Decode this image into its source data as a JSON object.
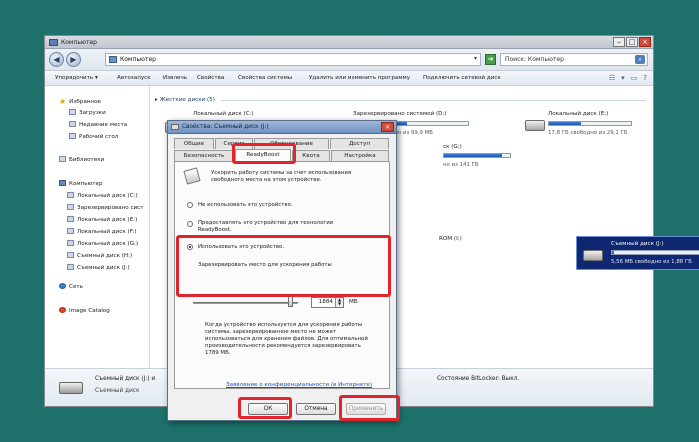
{
  "window": {
    "title": "Компьютер",
    "address": "Компьютер",
    "search_placeholder": "Поиск: Компьютер"
  },
  "commands": [
    "Упорядочить ▾",
    "Автозапуск",
    "Извлечь",
    "Свойства",
    "Свойства системы",
    "Удалить или изменить программу",
    "Подключить сетевой диск"
  ],
  "sidebar": {
    "favorites": "Избранное",
    "fav_items": [
      "Загрузки",
      "Недавние места",
      "Рабочий стол"
    ],
    "libraries": "Библиотеки",
    "computer": "Компьютер",
    "drives": [
      "Локальный диск (C:)",
      "Зарезервировано сист",
      "Локальный диск (E:)",
      "Локальный диск (F:)",
      "Локальный диск (G:)",
      "Съемный диск (H:)",
      "Съемный диск (J:)"
    ],
    "network": "Сеть",
    "image_catalog": "Image Catalog"
  },
  "main": {
    "group_hdd": "▸ Жесткие диски (5)",
    "drives": [
      {
        "name": "Локальный диск (C:)",
        "free": "",
        "used_frac": 0.62
      },
      {
        "name": "Зарезервировано системой (D:)",
        "free": "ено из 99,9 МБ",
        "used_frac": 0.2
      },
      {
        "name": "Локальный диск (E:)",
        "free": "17,8 ГБ свободно из 29,1 ГБ",
        "used_frac": 0.39
      },
      {
        "name": "ск (G:)",
        "free": "но из 141 ГБ",
        "used_frac": 0.88
      }
    ],
    "other_drive": "ROM (I:)",
    "selected": {
      "name": "Съемный диск (J:)",
      "free": "5,56 МБ свободно из 1,88 ГБ",
      "used_frac": 0.02
    }
  },
  "details": {
    "name": "Съемный диск (J:) и",
    "type": "Съемный диск",
    "bitlocker": "Состояние BitLocker: Выкл."
  },
  "dialog": {
    "title": "Свойства: Съемный диск (J:)",
    "tabs_row1": [
      "Общие",
      "Сервис",
      "Оборудование",
      "Доступ"
    ],
    "tabs_row2": [
      "Безопасность",
      "ReadyBoost",
      "Квота",
      "Настройка"
    ],
    "intro": "Ускорить работу системы за счет использования свободного места на этом устройстве.",
    "opt1": "Не использовать это устройство.",
    "opt2": "Предоставлять это устройство для технологии ReadyBoost.",
    "opt3": "Использовать это устройство.",
    "reserve_label": "Зарезервировать место для ускорения работы",
    "reserve_value": "1884",
    "unit": "МБ",
    "note": "Когда устройство используется для ускорения работы системы, зарезервированное место не может использоваться для хранения файлов. Для оптимальной производительности рекомендуется зарезервировать 1789 МБ.",
    "privacy_link": "Заявление о конфиденциальности (в Интернете)",
    "ok": "ОК",
    "cancel": "Отмена",
    "apply": "Применить"
  }
}
